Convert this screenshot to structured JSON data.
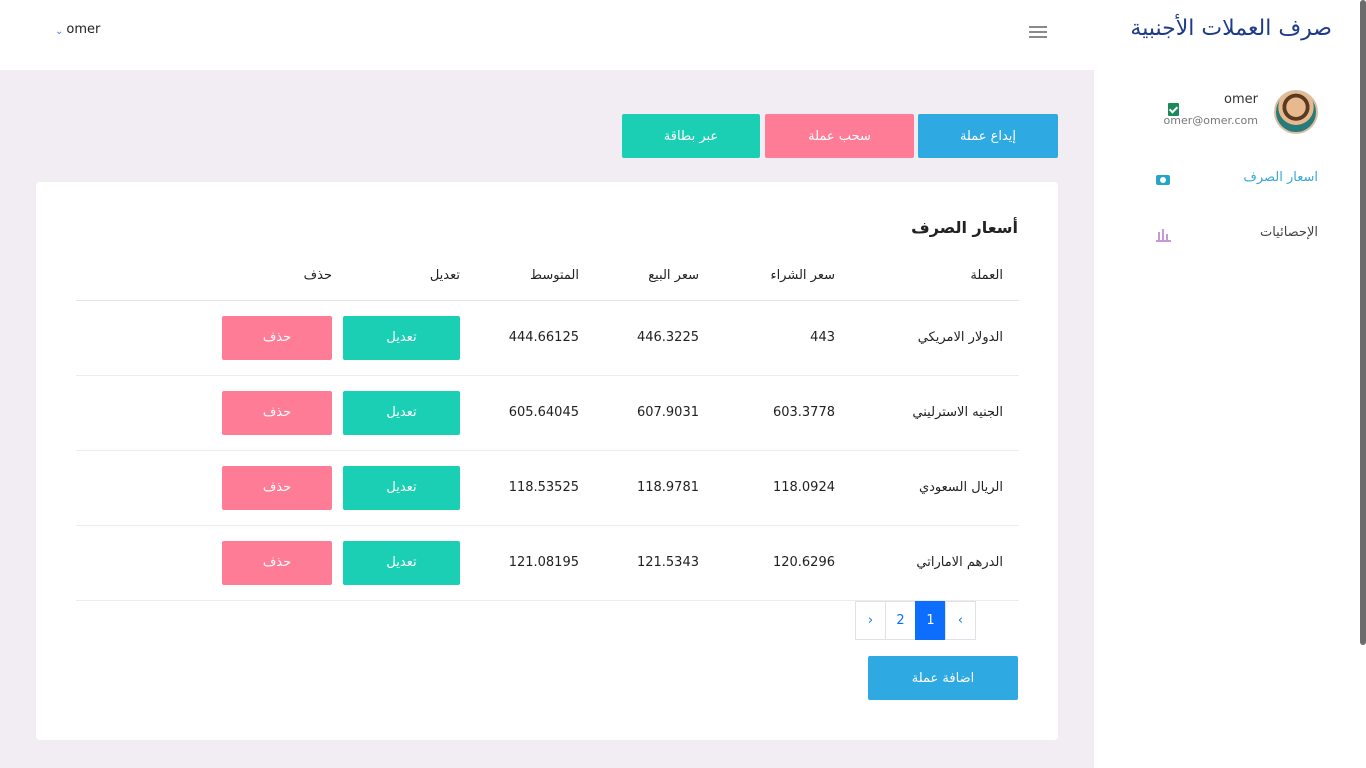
{
  "app": {
    "title": "صرف العملات الأجنبية"
  },
  "topbar": {
    "user": "omer"
  },
  "profile": {
    "name": "omer",
    "email": "omer@omer.com"
  },
  "nav": [
    {
      "label": "اسعار الصرف",
      "icon": "money-icon",
      "active": true
    },
    {
      "label": "الإحصائيات",
      "icon": "bar-chart-icon",
      "active": false
    }
  ],
  "actions": {
    "deposit": "إيداع عملة",
    "withdraw": "سحب عملة",
    "card": "عبر بطاقة"
  },
  "rates": {
    "title": "أسعار الصرف",
    "columns": {
      "currency": "العملة",
      "buy": "سعر الشراء",
      "sell": "سعر البيع",
      "avg": "المتوسط",
      "edit": "تعديل",
      "delete": "حذف"
    },
    "rows": [
      {
        "currency": "الدولار الامريكي",
        "buy": "443",
        "sell": "446.3225",
        "avg": "444.66125",
        "edit": "تعديل",
        "delete": "حذف"
      },
      {
        "currency": "الجنيه الاسترليني",
        "buy": "603.3778",
        "sell": "607.9031",
        "avg": "605.64045",
        "edit": "تعديل",
        "delete": "حذف"
      },
      {
        "currency": "الريال السعودي",
        "buy": "118.0924",
        "sell": "118.9781",
        "avg": "118.53525",
        "edit": "تعديل",
        "delete": "حذف"
      },
      {
        "currency": "الدرهم الاماراتي",
        "buy": "120.6296",
        "sell": "121.5343",
        "avg": "121.08195",
        "edit": "تعديل",
        "delete": "حذف"
      }
    ],
    "pagination": {
      "prev": "‹",
      "pages": [
        "1",
        "2"
      ],
      "current": "1",
      "next": "›"
    },
    "add_label": "اضافة عملة"
  },
  "colors": {
    "blue": "#2fa9e2",
    "pink": "#fe7c96",
    "teal": "#1bcfb4",
    "page_active": "#0d6efd",
    "brand_text": "#1e3a8a"
  }
}
